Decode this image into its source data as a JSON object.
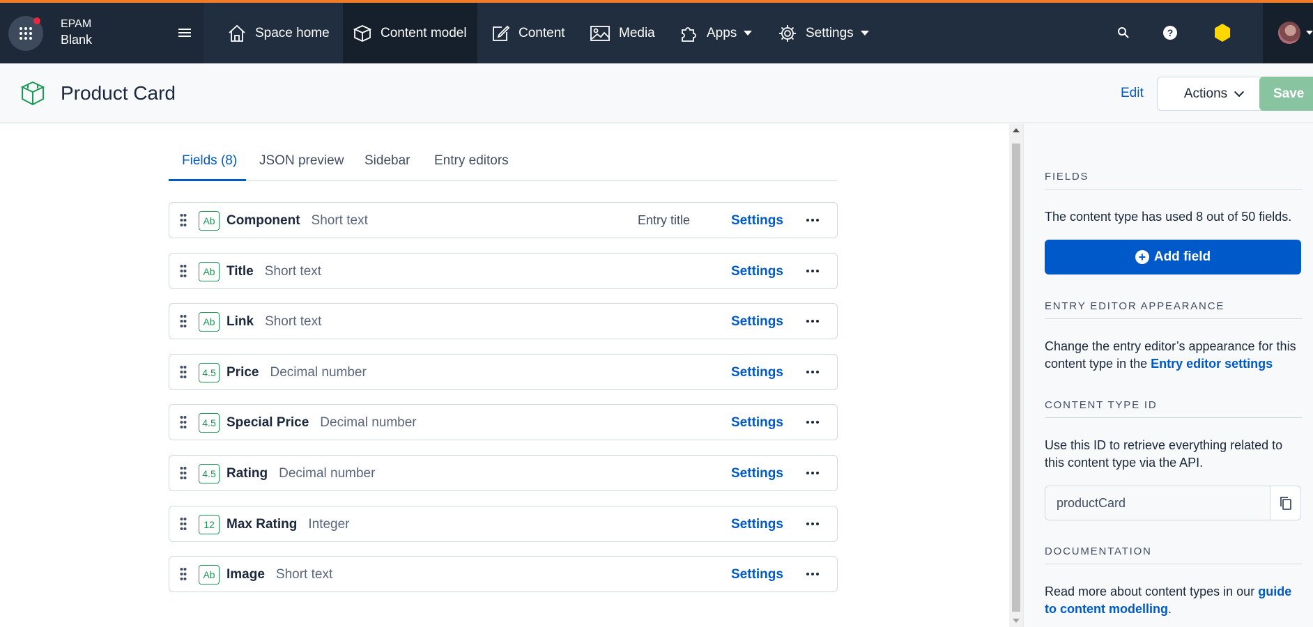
{
  "topbar": {
    "org": "EPAM",
    "environment": "Blank",
    "nav": [
      {
        "label": "Space home",
        "icon": "home-icon"
      },
      {
        "label": "Content model",
        "icon": "content-model-icon",
        "active": true
      },
      {
        "label": "Content",
        "icon": "content-edit-icon"
      },
      {
        "label": "Media",
        "icon": "media-icon"
      },
      {
        "label": "Apps",
        "icon": "puzzle-icon",
        "dropdown": true
      },
      {
        "label": "Settings",
        "icon": "gear-icon",
        "dropdown": true
      }
    ],
    "accent_color": "#f07b24"
  },
  "header": {
    "title": "Product Card",
    "edit_label": "Edit",
    "actions_label": "Actions",
    "save_label": "Save"
  },
  "tabs": [
    {
      "label": "Fields (8)",
      "active": true
    },
    {
      "label": "JSON preview"
    },
    {
      "label": "Sidebar"
    },
    {
      "label": "Entry editors"
    }
  ],
  "fields": [
    {
      "icon_text": "Ab",
      "name": "Component",
      "type": "Short text",
      "badge": "Entry title",
      "settings": "Settings"
    },
    {
      "icon_text": "Ab",
      "name": "Title",
      "type": "Short text",
      "badge": "",
      "settings": "Settings"
    },
    {
      "icon_text": "Ab",
      "name": "Link",
      "type": "Short text",
      "badge": "",
      "settings": "Settings"
    },
    {
      "icon_text": "4.5",
      "name": "Price",
      "type": "Decimal number",
      "badge": "",
      "settings": "Settings"
    },
    {
      "icon_text": "4.5",
      "name": "Special Price",
      "type": "Decimal number",
      "badge": "",
      "settings": "Settings"
    },
    {
      "icon_text": "4.5",
      "name": "Rating",
      "type": "Decimal number",
      "badge": "",
      "settings": "Settings"
    },
    {
      "icon_text": "12",
      "name": "Max Rating",
      "type": "Integer",
      "badge": "",
      "settings": "Settings"
    },
    {
      "icon_text": "Ab",
      "name": "Image",
      "type": "Short text",
      "badge": "",
      "settings": "Settings"
    }
  ],
  "sidebar": {
    "fields_heading": "FIELDS",
    "fields_text": "The content type has used 8 out of 50 fields.",
    "add_field_label": "Add field",
    "appearance_heading": "ENTRY EDITOR APPEARANCE",
    "appearance_text": "Change the entry editor’s appearance for this content type in the",
    "appearance_link": "Entry editor settings",
    "id_heading": "CONTENT TYPE ID",
    "id_text": "Use this ID to retrieve everything related to this content type via the API.",
    "id_value": "productCard",
    "docs_heading": "DOCUMENTATION",
    "docs_text": "Read more about content types in our",
    "docs_link": "guide to content modelling",
    "docs_suffix": "."
  }
}
